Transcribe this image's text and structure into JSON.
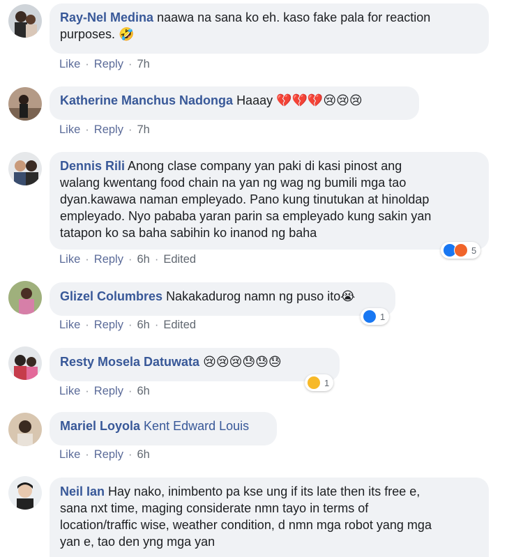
{
  "labels": {
    "like": "Like",
    "reply": "Reply",
    "edited": "Edited",
    "sep": "·"
  },
  "comments": [
    {
      "author": "Ray-Nel Medina",
      "text": "naawa na sana ko eh. kaso fake pala for reaction",
      "text2": "purposes. 🤣",
      "time": "7h"
    },
    {
      "author": "Katherine Manchus Nadonga",
      "text": "Haaay 💔💔💔😢😢😢",
      "time": "7h"
    },
    {
      "author": "Dennis Rili",
      "lines": [
        "Anong clase company yan paki di kasi pinost ang",
        "walang kwentang food chain na yan ng wag ng bumili mga tao",
        "dyan.kawawa naman empleyado. Pano kung tinutukan at hinoldap",
        "empleyado. Nyo pababa yaran parin sa empleyado kung sakin yan",
        "tatapon ko sa baha sabihin ko inanod ng baha"
      ],
      "time": "6h",
      "edited": true,
      "reaction_count": "5",
      "reaction_icons": [
        "like-icon",
        "angry-icon"
      ]
    },
    {
      "author": "Glizel Columbres",
      "text": "Nakakadurog namn ng puso ito😭",
      "time": "6h",
      "edited": true,
      "reaction_count": "1",
      "reaction_icons": [
        "like-icon"
      ]
    },
    {
      "author": "Resty Mosela Datuwata",
      "text": "😢😢😢😓😓😓",
      "time": "6h",
      "reaction_count": "1",
      "reaction_icons": [
        "haha-icon"
      ]
    },
    {
      "author": "Mariel Loyola",
      "text": "Kent Edward Louis",
      "time": "6h",
      "mention": true
    },
    {
      "author": "Neil Ian",
      "lines": [
        "Hay nako, inimbento pa kse ung if its late then its free e,",
        "sana nxt time, maging considerate nmn tayo in terms of",
        "location/traffic wise, weather condition, d nmn mga robot yang mga",
        "yan e, tao den yng mga yan"
      ]
    }
  ],
  "colors": {
    "bubble": "#f0f2f5",
    "author": "#385898",
    "meta": "#606770",
    "like": "#1877f2"
  }
}
